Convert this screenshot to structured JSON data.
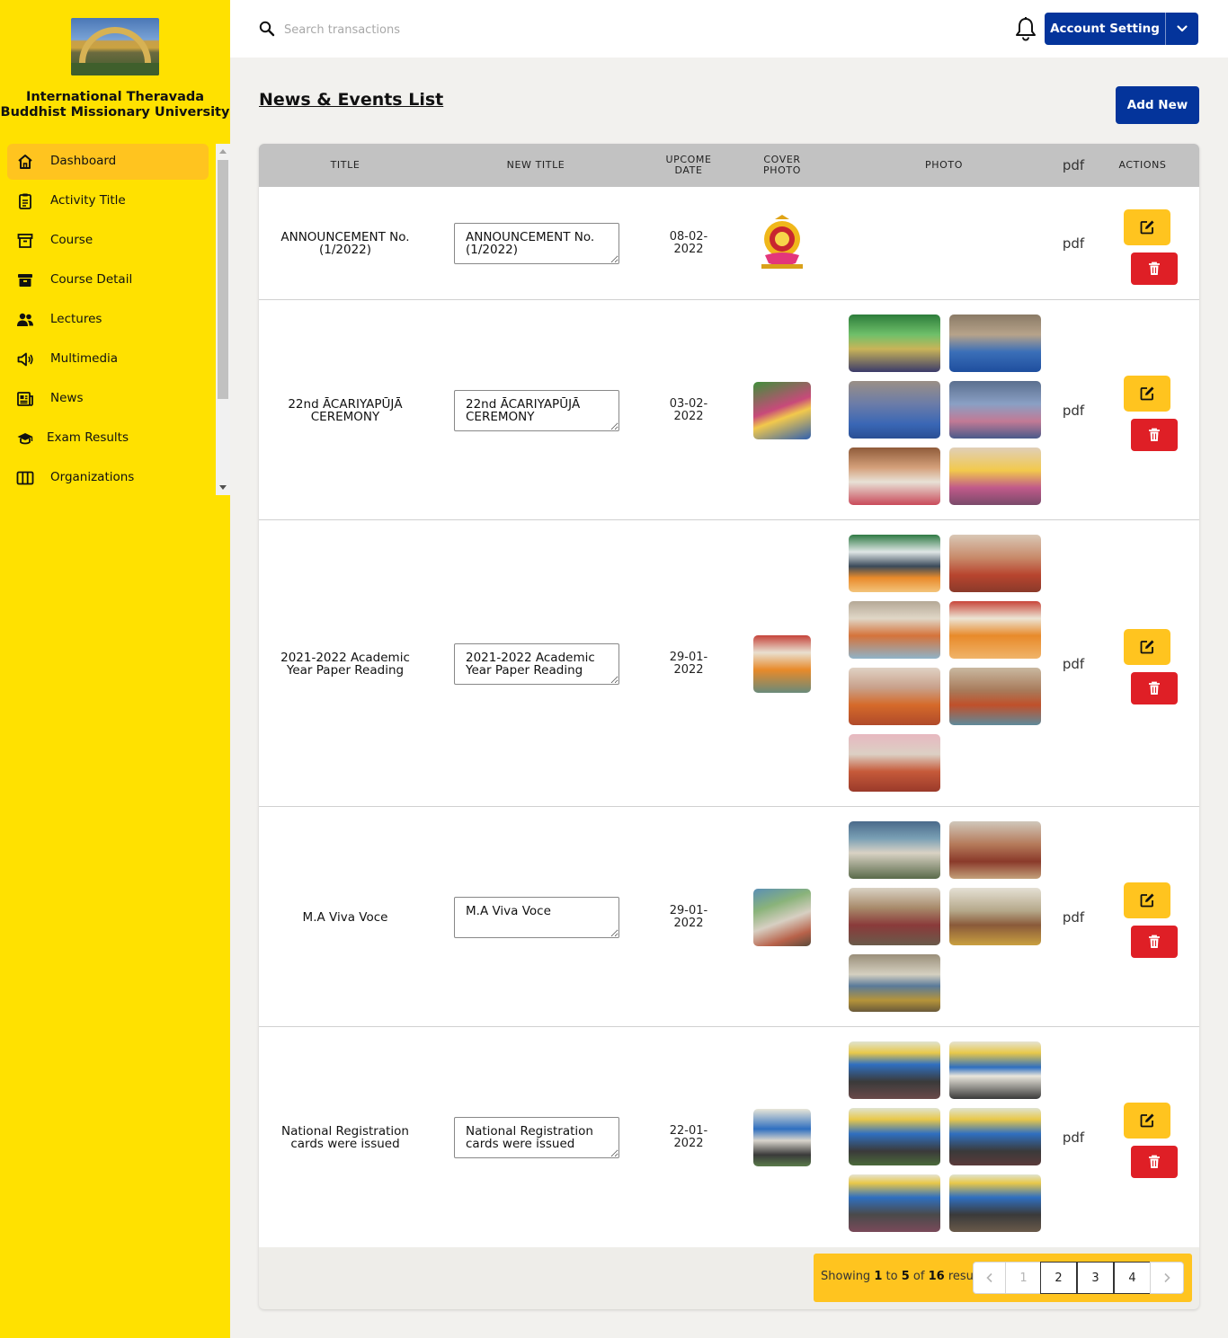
{
  "sidebar": {
    "university_name_line1": "International Theravada",
    "university_name_line2": "Buddhist Missionary University",
    "items": [
      {
        "label": "Dashboard",
        "icon": "home-icon",
        "active": true
      },
      {
        "label": "Activity Title",
        "icon": "clipboard-icon"
      },
      {
        "label": "Course",
        "icon": "archive-icon"
      },
      {
        "label": "Course Detail",
        "icon": "archive-filled-icon"
      },
      {
        "label": "Lectures",
        "icon": "users-icon"
      },
      {
        "label": "Multimedia",
        "icon": "speaker-icon"
      },
      {
        "label": "News",
        "icon": "newspaper-icon"
      },
      {
        "label": "Exam Results",
        "icon": "graduation-cap-icon"
      },
      {
        "label": "Organizations",
        "icon": "columns-icon"
      }
    ]
  },
  "topbar": {
    "search_placeholder": "Search transactions",
    "account_label": "Account Setting"
  },
  "page": {
    "title": "News & Events List",
    "add_label": "Add New"
  },
  "table": {
    "headers": {
      "title": "TITLE",
      "new_title": "NEW TITLE",
      "upcome_date_1": "UPCOME",
      "upcome_date_2": "DATE",
      "cover_1": "COVER",
      "cover_2": "PHOTO",
      "photo": "PHOTO",
      "pdf": "pdf",
      "actions": "ACTIONS"
    },
    "rows": [
      {
        "title": "ANNOUNCEMENT No. (1/2022)",
        "new_title": "ANNOUNCEMENT No. (1/2022)",
        "date_1": "08-02-",
        "date_2": "2022",
        "pdf": "pdf",
        "photo_count": 0
      },
      {
        "title": "22nd ĀCARIYAPŪJĀ CEREMONY",
        "new_title": "22nd ĀCARIYAPŪJĀ CEREMONY",
        "date_1": "03-02-",
        "date_2": "2022",
        "pdf": "pdf",
        "photo_count": 6
      },
      {
        "title": "2021-2022 Academic Year Paper Reading",
        "new_title": "2021-2022 Academic Year Paper Reading",
        "date_1": "29-01-",
        "date_2": "2022",
        "pdf": "pdf",
        "photo_count": 7
      },
      {
        "title": "M.A Viva Voce",
        "new_title": "M.A Viva Voce",
        "date_1": "29-01-",
        "date_2": "2022",
        "pdf": "pdf",
        "photo_count": 5
      },
      {
        "title": "National Registration cards were issued",
        "new_title": "National Registration cards were issued",
        "date_1": "22-01-",
        "date_2": "2022",
        "pdf": "pdf",
        "photo_count": 6
      }
    ]
  },
  "pagination": {
    "showing": "Showing",
    "from": "1",
    "to_word": "to",
    "to": "5",
    "of_word": "of",
    "total": "16",
    "results_word": "results",
    "pages": [
      "1",
      "2",
      "3",
      "4"
    ],
    "prev_icon": "chevron-left-icon",
    "next_icon": "chevron-right-icon"
  },
  "colors": {
    "sidebar_bg": "#ffe100",
    "active_item": "#ffc41f",
    "primary_blue": "#04349b",
    "edit_yellow": "#ffc41f",
    "delete_red": "#df1f26"
  }
}
